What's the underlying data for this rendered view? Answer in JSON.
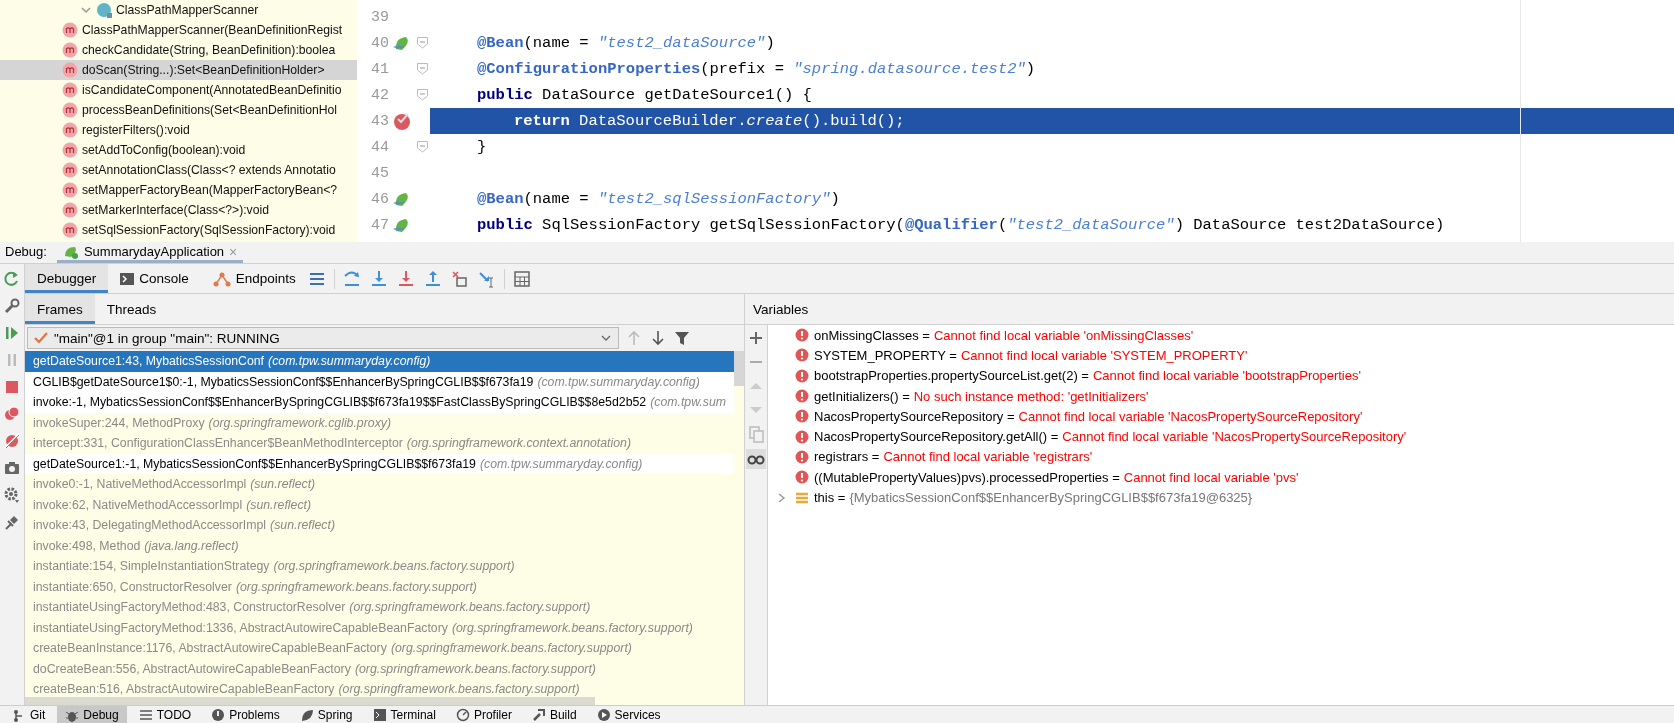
{
  "structure": {
    "class_name": "ClassPathMapperScanner",
    "expanded": true,
    "methods": [
      {
        "label": "ClassPathMapperScanner(BeanDefinitionRegist",
        "selected": false
      },
      {
        "label": "checkCandidate(String, BeanDefinition):boolea",
        "selected": false
      },
      {
        "label": "doScan(String...):Set<BeanDefinitionHolder>",
        "selected": true
      },
      {
        "label": "isCandidateComponent(AnnotatedBeanDefinitio",
        "selected": false
      },
      {
        "label": "processBeanDefinitions(Set<BeanDefinitionHol",
        "selected": false
      },
      {
        "label": "registerFilters():void",
        "selected": false
      },
      {
        "label": "setAddToConfig(boolean):void",
        "selected": false
      },
      {
        "label": "setAnnotationClass(Class<? extends Annotatio",
        "selected": false
      },
      {
        "label": "setMapperFactoryBean(MapperFactoryBean<?",
        "selected": false
      },
      {
        "label": "setMarkerInterface(Class<?>):void",
        "selected": false
      },
      {
        "label": "setSqlSessionFactory(SqlSessionFactory):void",
        "selected": false
      }
    ]
  },
  "editor": {
    "lines": [
      {
        "number": "39",
        "bean": false,
        "breakpoint": false,
        "fold": false,
        "highlighted": false
      },
      {
        "number": "40",
        "bean": true,
        "breakpoint": false,
        "fold": true,
        "highlighted": false,
        "indented": false,
        "tokens": [
          {
            "kind": "annotation",
            "text": "@Bean"
          },
          {
            "kind": "plain",
            "text": "(name = "
          },
          {
            "kind": "string",
            "text": "\"test2_dataSource\""
          },
          {
            "kind": "plain",
            "text": ")"
          }
        ]
      },
      {
        "number": "41",
        "bean": false,
        "breakpoint": false,
        "fold": true,
        "highlighted": false,
        "indented": false,
        "tokens": [
          {
            "kind": "annotation",
            "text": "@ConfigurationProperties"
          },
          {
            "kind": "plain",
            "text": "(prefix = "
          },
          {
            "kind": "string",
            "text": "\"spring.datasource.test2\""
          },
          {
            "kind": "plain",
            "text": ")"
          }
        ]
      },
      {
        "number": "42",
        "bean": false,
        "breakpoint": false,
        "fold": true,
        "highlighted": false,
        "indented": false,
        "tokens": [
          {
            "kind": "keyword",
            "text": "public"
          },
          {
            "kind": "plain",
            "text": " DataSource getDateSource1() {"
          }
        ]
      },
      {
        "number": "43",
        "bean": false,
        "breakpoint": true,
        "fold": false,
        "highlighted": true,
        "indented": true,
        "tokens": [
          {
            "kind": "keyword",
            "text": "return"
          },
          {
            "kind": "plain",
            "text": " DataSourceBuilder."
          },
          {
            "kind": "italic",
            "text": "create"
          },
          {
            "kind": "plain",
            "text": "().build();"
          }
        ]
      },
      {
        "number": "44",
        "bean": false,
        "breakpoint": false,
        "fold": true,
        "highlighted": false,
        "indented": false,
        "tokens": [
          {
            "kind": "plain",
            "text": "}"
          }
        ]
      },
      {
        "number": "45",
        "bean": false,
        "breakpoint": false,
        "fold": false,
        "highlighted": false
      },
      {
        "number": "46",
        "bean": true,
        "breakpoint": false,
        "fold": false,
        "highlighted": false,
        "indented": false,
        "tokens": [
          {
            "kind": "annotation",
            "text": "@Bean"
          },
          {
            "kind": "plain",
            "text": "(name = "
          },
          {
            "kind": "string",
            "text": "\"test2_sqlSessionFactory\""
          },
          {
            "kind": "plain",
            "text": ")"
          }
        ]
      },
      {
        "number": "47",
        "bean": true,
        "breakpoint": false,
        "fold": false,
        "highlighted": false,
        "indented": false,
        "tokens": [
          {
            "kind": "keyword",
            "text": "public"
          },
          {
            "kind": "plain",
            "text": " SqlSessionFactory getSqlSessionFactory("
          },
          {
            "kind": "annotation",
            "text": "@Qualifier"
          },
          {
            "kind": "plain",
            "text": "("
          },
          {
            "kind": "string",
            "text": "\"test2_dataSource\""
          },
          {
            "kind": "plain",
            "text": ") DataSource test2DataSource)"
          }
        ]
      }
    ]
  },
  "debug": {
    "label": "Debug:",
    "session": {
      "title": "SummarydayApplication",
      "close": "×"
    },
    "tabs": [
      {
        "label": "Debugger",
        "selected": true
      },
      {
        "label": "Console",
        "selected": false
      },
      {
        "label": "Endpoints",
        "selected": false
      }
    ],
    "frames_tabs": [
      {
        "label": "Frames",
        "selected": true
      },
      {
        "label": "Threads",
        "selected": false
      }
    ],
    "thread": {
      "value": "\"main\"@1 in group \"main\": RUNNING"
    },
    "frames": [
      {
        "location": "getDateSource1:43, MybaticsSessionConf",
        "package": "(com.tpw.summaryday.config)",
        "selected": true,
        "dimmed": false
      },
      {
        "location": "CGLIB$getDateSource1$0:-1, MybaticsSessionConf$$EnhancerBySpringCGLIB$$f673fa19",
        "package": "(com.tpw.summaryday.config)",
        "selected": false,
        "dimmed": false
      },
      {
        "location": "invoke:-1, MybaticsSessionConf$$EnhancerBySpringCGLIB$$f673fa19$$FastClassBySpringCGLIB$$8e5d2b52",
        "package": "(com.tpw.sum",
        "selected": false,
        "dimmed": false
      },
      {
        "location": "invokeSuper:244, MethodProxy",
        "package": "(org.springframework.cglib.proxy)",
        "selected": false,
        "dimmed": true
      },
      {
        "location": "intercept:331, ConfigurationClassEnhancer$BeanMethodInterceptor",
        "package": "(org.springframework.context.annotation)",
        "selected": false,
        "dimmed": true
      },
      {
        "location": "getDateSource1:-1, MybaticsSessionConf$$EnhancerBySpringCGLIB$$f673fa19",
        "package": "(com.tpw.summaryday.config)",
        "selected": false,
        "dimmed": false
      },
      {
        "location": "invoke0:-1, NativeMethodAccessorImpl",
        "package": "(sun.reflect)",
        "selected": false,
        "dimmed": true
      },
      {
        "location": "invoke:62, NativeMethodAccessorImpl",
        "package": "(sun.reflect)",
        "selected": false,
        "dimmed": true
      },
      {
        "location": "invoke:43, DelegatingMethodAccessorImpl",
        "package": "(sun.reflect)",
        "selected": false,
        "dimmed": true
      },
      {
        "location": "invoke:498, Method",
        "package": "(java.lang.reflect)",
        "selected": false,
        "dimmed": true
      },
      {
        "location": "instantiate:154, SimpleInstantiationStrategy",
        "package": "(org.springframework.beans.factory.support)",
        "selected": false,
        "dimmed": true
      },
      {
        "location": "instantiate:650, ConstructorResolver",
        "package": "(org.springframework.beans.factory.support)",
        "selected": false,
        "dimmed": true
      },
      {
        "location": "instantiateUsingFactoryMethod:483, ConstructorResolver",
        "package": "(org.springframework.beans.factory.support)",
        "selected": false,
        "dimmed": true
      },
      {
        "location": "instantiateUsingFactoryMethod:1336, AbstractAutowireCapableBeanFactory",
        "package": "(org.springframework.beans.factory.support)",
        "selected": false,
        "dimmed": true
      },
      {
        "location": "createBeanInstance:1176, AbstractAutowireCapableBeanFactory",
        "package": "(org.springframework.beans.factory.support)",
        "selected": false,
        "dimmed": true
      },
      {
        "location": "doCreateBean:556, AbstractAutowireCapableBeanFactory",
        "package": "(org.springframework.beans.factory.support)",
        "selected": false,
        "dimmed": true
      },
      {
        "location": "createBean:516, AbstractAutowireCapableBeanFactory",
        "package": "(org.springframework.beans.factory.support)",
        "selected": false,
        "dimmed": true
      }
    ],
    "variables": {
      "title": "Variables",
      "items": [
        {
          "kind": "error",
          "name": "onMissingClasses =",
          "value": "Cannot find local variable 'onMissingClasses'"
        },
        {
          "kind": "error",
          "name": "SYSTEM_PROPERTY =",
          "value": "Cannot find local variable 'SYSTEM_PROPERTY'"
        },
        {
          "kind": "error",
          "name": "bootstrapProperties.propertySourceList.get(2) =",
          "value": "Cannot find local variable 'bootstrapProperties'"
        },
        {
          "kind": "error",
          "name": "getInitializers() =",
          "value": "No such instance method: 'getInitializers'"
        },
        {
          "kind": "error",
          "name": "NacosPropertySourceRepository =",
          "value": "Cannot find local variable 'NacosPropertySourceRepository'"
        },
        {
          "kind": "error",
          "name": "NacosPropertySourceRepository.getAll() =",
          "value": "Cannot find local variable 'NacosPropertySourceRepository'"
        },
        {
          "kind": "error",
          "name": "registrars =",
          "value": "Cannot find local variable 'registrars'"
        },
        {
          "kind": "error",
          "name": "((MutablePropertyValues)pvs).processedProperties =",
          "value": "Cannot find local variable 'pvs'"
        },
        {
          "kind": "object",
          "name": "this =",
          "value": "{MybaticsSessionConf$$EnhancerBySpringCGLIB$$f673fa19@6325}"
        }
      ]
    }
  },
  "tool_windows": [
    {
      "label": "Git",
      "selected": false
    },
    {
      "label": "Debug",
      "selected": true
    },
    {
      "label": "TODO",
      "selected": false
    },
    {
      "label": "Problems",
      "selected": false
    },
    {
      "label": "Spring",
      "selected": false
    },
    {
      "label": "Terminal",
      "selected": false
    },
    {
      "label": "Profiler",
      "selected": false
    },
    {
      "label": "Build",
      "selected": false
    },
    {
      "label": "Services",
      "selected": false
    }
  ]
}
